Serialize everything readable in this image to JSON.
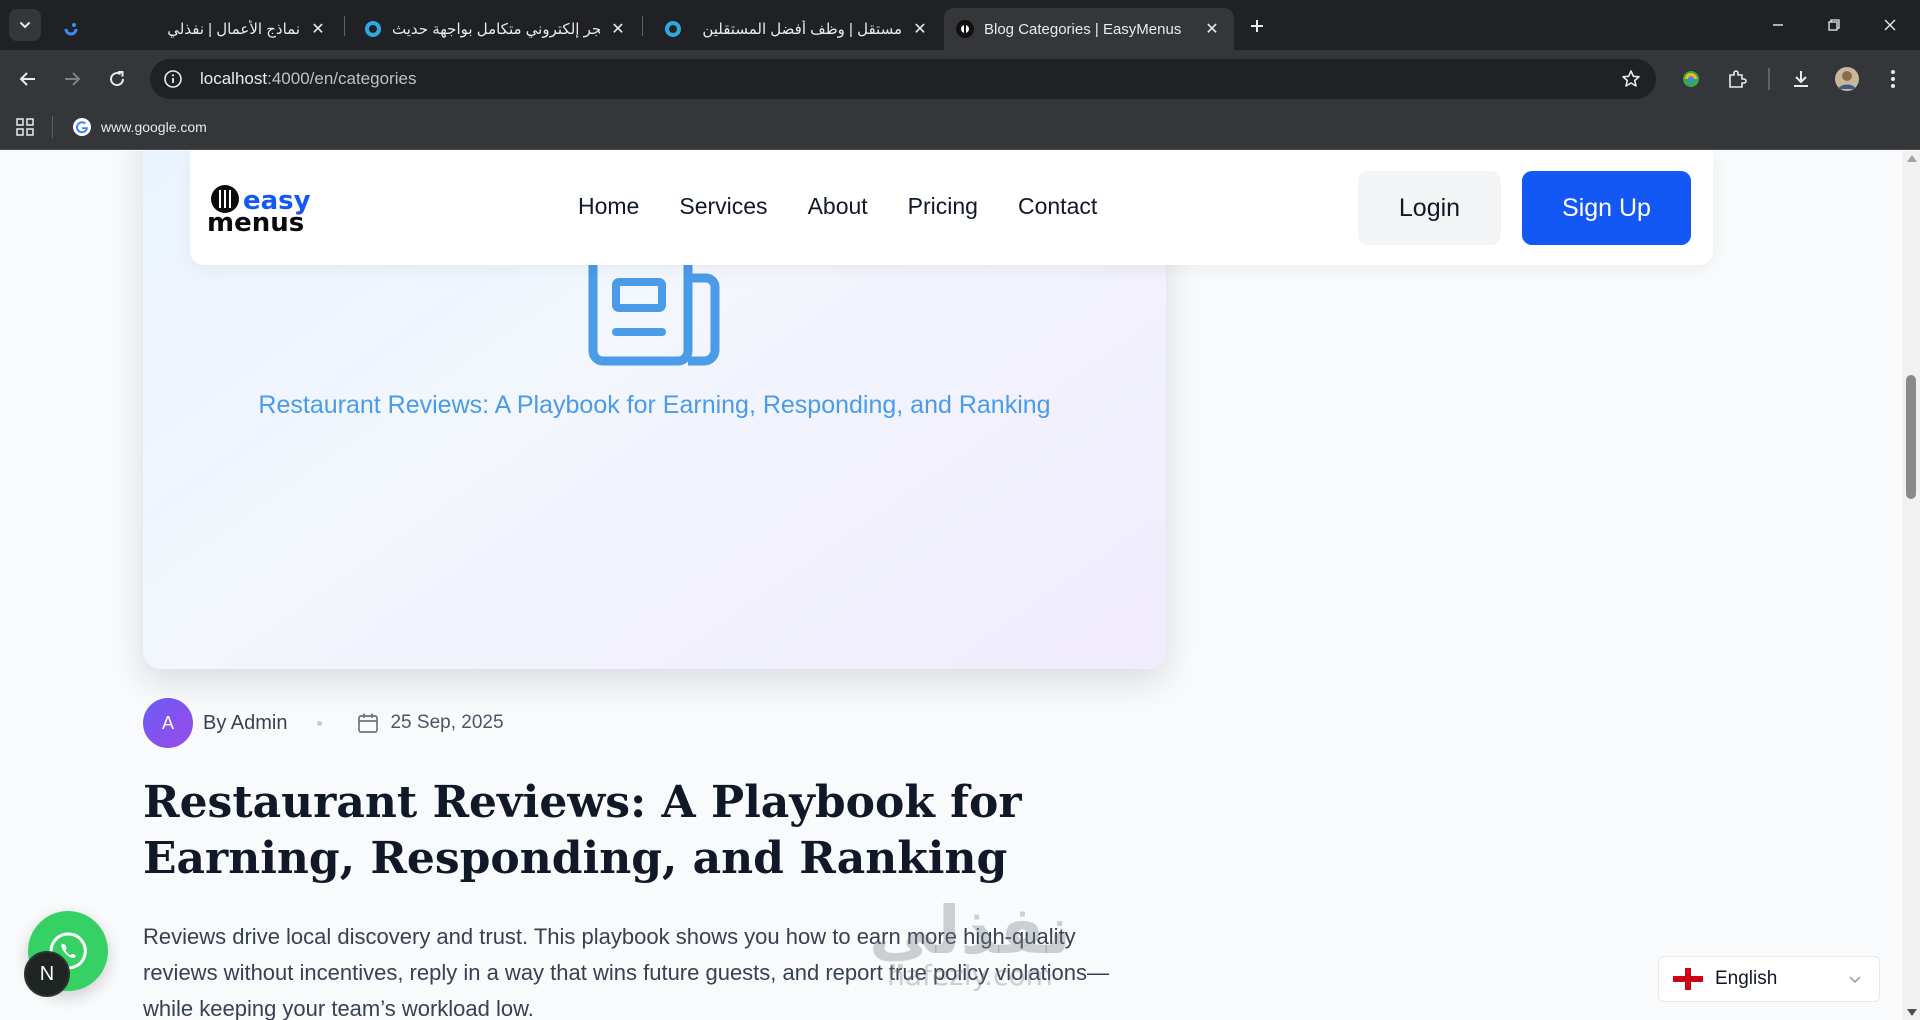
{
  "browser": {
    "tabs": [
      {
        "title": "نماذج الأعمال | نفذلي",
        "active": false
      },
      {
        "title": "متجر إلكتروني متكامل بواجهة حديث",
        "active": false
      },
      {
        "title": "مستقل | وظف أفضل المستقلين",
        "active": false
      },
      {
        "title": "Blog Categories | EasyMenus",
        "active": true
      }
    ],
    "url_host": "localhost",
    "url_path": ":4000/en/categories",
    "bookmark": "www.google.com"
  },
  "site": {
    "logo_top": "easy",
    "logo_bottom": "menus",
    "nav": [
      "Home",
      "Services",
      "About",
      "Pricing",
      "Contact"
    ],
    "login_label": "Login",
    "signup_label": "Sign Up",
    "brand_color": "#1357f5"
  },
  "post": {
    "hero_text": "Restaurant Reviews: A Playbook for Earning, Responding, and Ranking",
    "author_initial": "A",
    "author": "By Admin",
    "date": "25 Sep, 2025",
    "title": "Restaurant Reviews: A Playbook for Earning, Responding, and Ranking",
    "excerpt": "Reviews drive local discovery and trust. This playbook shows you how to earn more high-quality reviews without incentives, reply in a way that wins future guests, and report true policy violations—while keeping your team’s workload low."
  },
  "widgets": {
    "n_badge": "N",
    "language": "English"
  },
  "watermark": {
    "ar": "نفذلي",
    "en": "nafezly.com"
  }
}
